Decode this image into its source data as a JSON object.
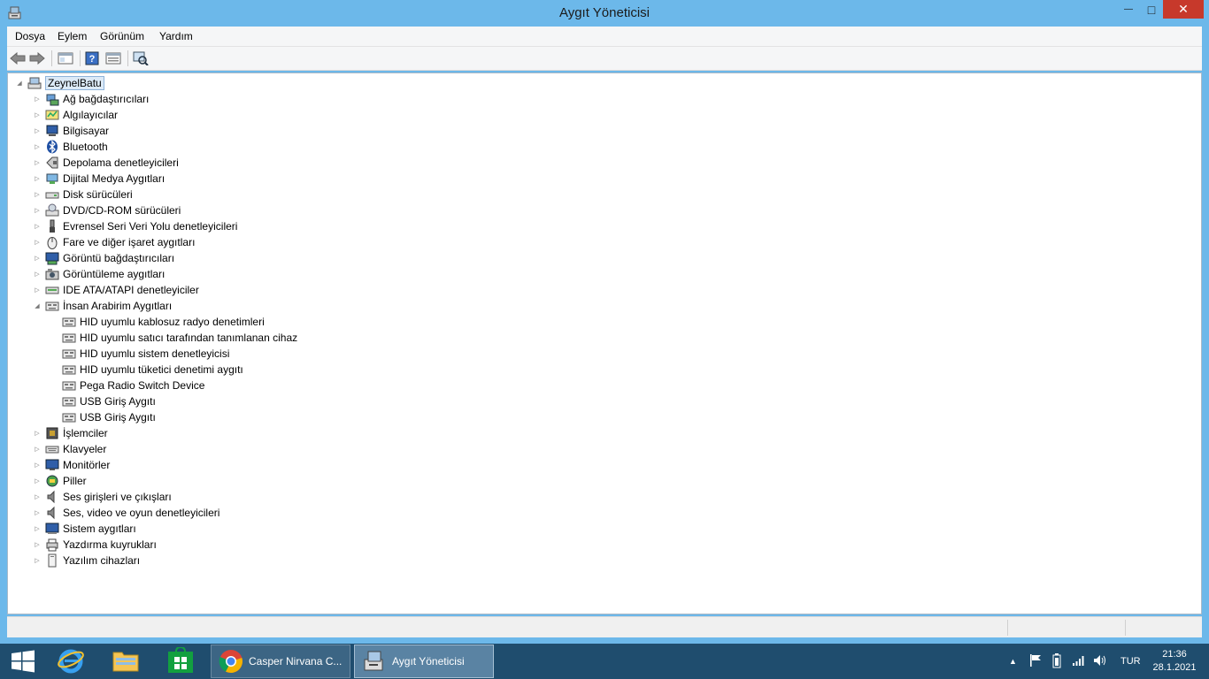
{
  "window": {
    "title": "Aygıt Yöneticisi",
    "close_glyph": "✕",
    "minimize_glyph": "—",
    "maximize_glyph": "□"
  },
  "menu": [
    "Dosya",
    "Eylem",
    "Görünüm",
    "Yardım"
  ],
  "toolbar": {
    "icons": [
      "back-arrow-icon",
      "forward-arrow-icon",
      "properties-panel-icon",
      "help-icon",
      "update-driver-icon",
      "scan-hardware-icon"
    ]
  },
  "tree": {
    "root": "ZeynelBatu",
    "categories": [
      {
        "label": "Ağ bağdaştırıcıları",
        "icon": "network-adapter-icon",
        "expanded": false
      },
      {
        "label": "Algılayıcılar",
        "icon": "sensor-icon",
        "expanded": false
      },
      {
        "label": "Bilgisayar",
        "icon": "computer-icon",
        "expanded": false
      },
      {
        "label": "Bluetooth",
        "icon": "bluetooth-icon",
        "expanded": false
      },
      {
        "label": "Depolama denetleyicileri",
        "icon": "storage-controller-icon",
        "expanded": false
      },
      {
        "label": "Dijital Medya Aygıtları",
        "icon": "digital-media-icon",
        "expanded": false
      },
      {
        "label": "Disk sürücüleri",
        "icon": "disk-drive-icon",
        "expanded": false
      },
      {
        "label": "DVD/CD-ROM sürücüleri",
        "icon": "dvd-drive-icon",
        "expanded": false
      },
      {
        "label": "Evrensel Seri Veri Yolu denetleyicileri",
        "icon": "usb-controller-icon",
        "expanded": false
      },
      {
        "label": "Fare ve diğer işaret aygıtları",
        "icon": "mouse-icon",
        "expanded": false
      },
      {
        "label": "Görüntü bağdaştırıcıları",
        "icon": "display-adapter-icon",
        "expanded": false
      },
      {
        "label": "Görüntüleme aygıtları",
        "icon": "imaging-device-icon",
        "expanded": false
      },
      {
        "label": "IDE ATA/ATAPI denetleyiciler",
        "icon": "ide-controller-icon",
        "expanded": false
      },
      {
        "label": "İnsan Arabirim Aygıtları",
        "icon": "hid-icon",
        "expanded": true,
        "children": [
          "HID uyumlu kablosuz radyo denetimleri",
          "HID uyumlu satıcı tarafından tanımlanan cihaz",
          "HID uyumlu sistem denetleyicisi",
          "HID uyumlu tüketici denetimi aygıtı",
          "Pega Radio Switch Device",
          "USB Giriş Aygıtı",
          "USB Giriş Aygıtı"
        ]
      },
      {
        "label": "İşlemciler",
        "icon": "processor-icon",
        "expanded": false
      },
      {
        "label": "Klavyeler",
        "icon": "keyboard-icon",
        "expanded": false
      },
      {
        "label": "Monitörler",
        "icon": "monitor-icon",
        "expanded": false
      },
      {
        "label": "Piller",
        "icon": "battery-icon",
        "expanded": false
      },
      {
        "label": "Ses girişleri ve çıkışları",
        "icon": "audio-io-icon",
        "expanded": false
      },
      {
        "label": "Ses, video ve oyun denetleyicileri",
        "icon": "sound-controller-icon",
        "expanded": false
      },
      {
        "label": "Sistem aygıtları",
        "icon": "system-device-icon",
        "expanded": false
      },
      {
        "label": "Yazdırma kuyrukları",
        "icon": "print-queue-icon",
        "expanded": false
      },
      {
        "label": "Yazılım cihazları",
        "icon": "software-device-icon",
        "expanded": false
      }
    ]
  },
  "taskbar": {
    "tasks": [
      {
        "label": "Casper Nirvana C...",
        "icon": "chrome-icon"
      },
      {
        "label": "Aygıt Yöneticisi",
        "icon": "device-manager-icon"
      }
    ],
    "language": "TUR",
    "time": "21:36",
    "date": "28.1.2021"
  },
  "colors": {
    "titlebar": "#6cb8ea",
    "close_button": "#c7392b",
    "taskbar": "#1f4d6e",
    "selection": "#dceaf7"
  }
}
